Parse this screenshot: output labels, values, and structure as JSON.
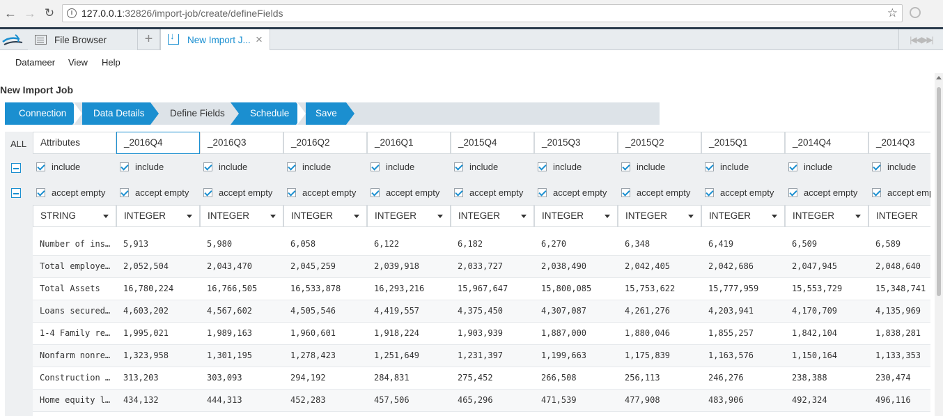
{
  "browser": {
    "url_host": "127.0.0.1",
    "url_rest": ":32826/import-job/create/defineFields"
  },
  "tabs": [
    {
      "label": "File Browser"
    },
    {
      "label": "New Import J..."
    }
  ],
  "menu": [
    "Datameer",
    "View",
    "Help"
  ],
  "page_title": "New Import Job",
  "wizard_steps": [
    {
      "label": "Connection",
      "active": true
    },
    {
      "label": "Data Details",
      "active": true
    },
    {
      "label": "Define Fields",
      "active": false
    },
    {
      "label": "Schedule",
      "active": true
    },
    {
      "label": "Save",
      "active": true
    }
  ],
  "grid": {
    "all_label": "ALL",
    "include_label": "include",
    "accept_empty_label": "accept empty",
    "columns": [
      {
        "name": "Attributes",
        "type": "STRING"
      },
      {
        "name": "_2016Q4",
        "type": "INTEGER"
      },
      {
        "name": "_2016Q3",
        "type": "INTEGER"
      },
      {
        "name": "_2016Q2",
        "type": "INTEGER"
      },
      {
        "name": "_2016Q1",
        "type": "INTEGER"
      },
      {
        "name": "_2015Q4",
        "type": "INTEGER"
      },
      {
        "name": "_2015Q3",
        "type": "INTEGER"
      },
      {
        "name": "_2015Q2",
        "type": "INTEGER"
      },
      {
        "name": "_2015Q1",
        "type": "INTEGER"
      },
      {
        "name": "_2014Q4",
        "type": "INTEGER"
      },
      {
        "name": "_2014Q3",
        "type": "INTEGER"
      }
    ],
    "rows": [
      [
        "Number of ins…",
        "5,913",
        "5,980",
        "6,058",
        "6,122",
        "6,182",
        "6,270",
        "6,348",
        "6,419",
        "6,509",
        "6,589"
      ],
      [
        "Total employe…",
        "2,052,504",
        "2,043,470",
        "2,045,259",
        "2,039,918",
        "2,033,727",
        "2,038,490",
        "2,042,405",
        "2,042,686",
        "2,047,945",
        "2,048,640"
      ],
      [
        "Total Assets",
        "16,780,224",
        "16,766,505",
        "16,533,878",
        "16,293,216",
        "15,967,647",
        "15,800,085",
        "15,753,622",
        "15,777,959",
        "15,553,729",
        "15,348,741"
      ],
      [
        "Loans secured…",
        "4,603,202",
        "4,567,602",
        "4,505,546",
        "4,419,557",
        "4,375,450",
        "4,307,087",
        "4,261,276",
        "4,203,941",
        "4,170,709",
        "4,135,969"
      ],
      [
        "1-4 Family re…",
        "1,995,021",
        "1,989,163",
        "1,960,601",
        "1,918,224",
        "1,903,939",
        "1,887,000",
        "1,880,046",
        "1,855,257",
        "1,842,104",
        "1,838,281"
      ],
      [
        "Nonfarm nonre…",
        "1,323,958",
        "1,301,195",
        "1,278,423",
        "1,251,649",
        "1,231,397",
        "1,199,663",
        "1,175,839",
        "1,163,576",
        "1,150,164",
        "1,133,353"
      ],
      [
        "Construction …",
        "313,203",
        "303,093",
        "294,192",
        "284,831",
        "275,452",
        "266,508",
        "256,113",
        "246,276",
        "238,388",
        "230,474"
      ],
      [
        "Home equity l…",
        "434,132",
        "444,313",
        "452,283",
        "457,506",
        "465,296",
        "471,539",
        "477,908",
        "483,906",
        "492,324",
        "496,116"
      ]
    ]
  }
}
